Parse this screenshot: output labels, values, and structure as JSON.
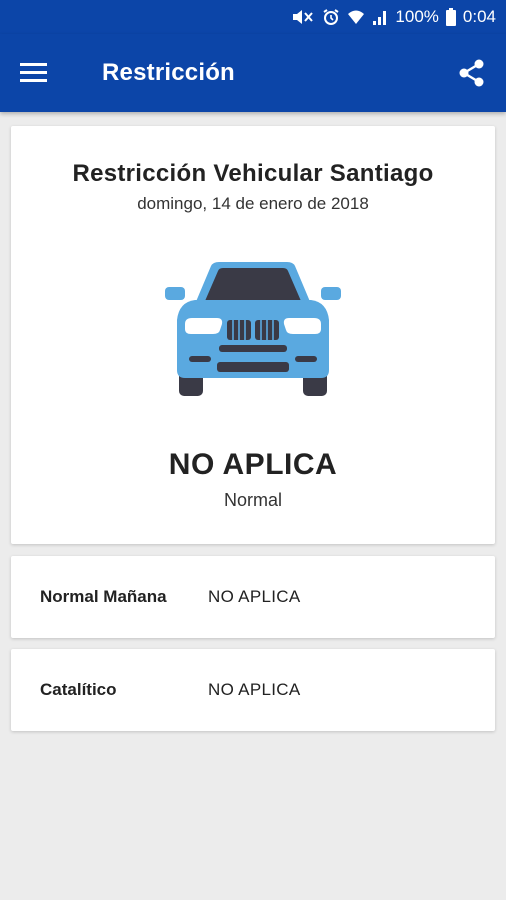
{
  "status_bar": {
    "battery_percent": "100%",
    "time": "0:04",
    "icons": [
      "mute-icon",
      "alarm-icon",
      "wifi-icon",
      "signal-icon",
      "battery-icon"
    ]
  },
  "app_bar": {
    "title": "Restricción",
    "color": "#0c45a8",
    "menu_icon": "hamburger-menu-icon",
    "share_icon": "share-icon"
  },
  "main_card": {
    "title": "Restricción Vehicular Santiago",
    "date": "domingo, 14 de enero de 2018",
    "car_icon": "car-front-icon",
    "car_color": "#5aa9e0",
    "status": "NO APLICA",
    "category": "Normal"
  },
  "rows": [
    {
      "label": "Normal Mañana",
      "value": "NO APLICA"
    },
    {
      "label": "Catalítico",
      "value": "NO APLICA"
    }
  ]
}
